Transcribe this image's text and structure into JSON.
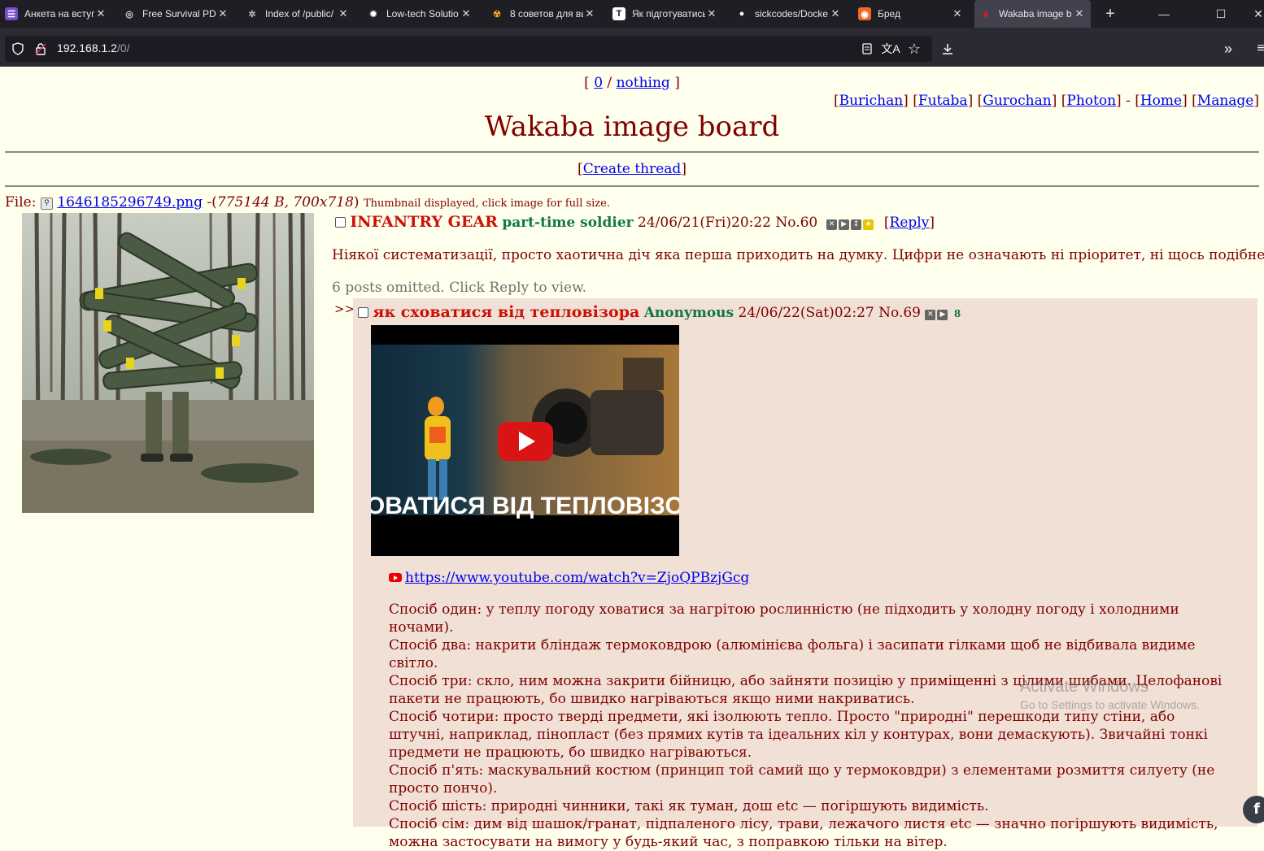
{
  "browser": {
    "tabs": [
      {
        "label": "Анкета на вступ",
        "icon": "form-icon",
        "icon_glyph": "☰",
        "icon_bg": "#7b4bd0",
        "active": false
      },
      {
        "label": "Free Survival PDF",
        "icon": "globe-icon",
        "icon_glyph": "◎",
        "icon_bg": "#1f1e25",
        "active": false
      },
      {
        "label": "Index of /public/",
        "icon": "spark-icon",
        "icon_glyph": "✲",
        "icon_bg": "#1f1e25",
        "active": false
      },
      {
        "label": "Low-tech Solutio",
        "icon": "sun-icon",
        "icon_glyph": "✹",
        "icon_bg": "#1f1e25",
        "active": false
      },
      {
        "label": "8 советов для вы",
        "icon": "radiation-icon",
        "icon_glyph": "☢",
        "icon_bg": "#1f1e25",
        "active": false
      },
      {
        "label": "Як підготуватись",
        "icon": "t-letter-icon",
        "icon_glyph": "T",
        "icon_bg": "#ffffff",
        "active": false
      },
      {
        "label": "sickcodes/Docke",
        "icon": "github-icon",
        "icon_glyph": "●",
        "icon_bg": "#1f1e25",
        "active": false
      },
      {
        "label": "Бред",
        "icon": "chat-icon",
        "icon_glyph": "◉",
        "icon_bg": "#f06a1d",
        "active": false
      },
      {
        "label": "Wakaba image b",
        "icon": "wakaba-drop-icon",
        "icon_glyph": "♦",
        "icon_bg": "#1f1e25",
        "active": true
      }
    ],
    "new_tab_glyph": "+",
    "url_host": "192.168.1.2",
    "url_path": "/0/"
  },
  "page": {
    "topnav": {
      "open": "[",
      "board": "0",
      "sep": "/",
      "nothing": "nothing",
      "close": "]"
    },
    "board_links": [
      {
        "label": "Burichan"
      },
      {
        "label": "Futaba"
      },
      {
        "label": "Gurochan"
      },
      {
        "label": "Photon"
      }
    ],
    "board_links_sep": "-",
    "site_links": [
      {
        "label": "Home"
      },
      {
        "label": "Manage"
      }
    ],
    "logo": "Wakaba image board",
    "create_thread": "Create thread",
    "file": {
      "label": "File:",
      "name": "1646185296749.png",
      "meta_prefix": "-(",
      "meta": "775144 B, 700x718",
      "meta_suffix": ")",
      "note": "Thumbnail displayed, click image for full size."
    },
    "op": {
      "subject": "INFANTRY GEAR",
      "name": "part-time soldier",
      "date": "24/06/21(Fri)20:22",
      "no": "No.60",
      "reply": "Reply",
      "text": "Ніякої систематизації, просто хаотична діч яка перша приходить на думку. Цифри не означають ні пріоритет, ні щось подібне."
    },
    "omitted": "6 posts omitted. Click Reply to view.",
    "reply": {
      "arrow": ">>",
      "subject": "як сховатися від тепловізора",
      "name": "Anonymous",
      "date": "24/06/22(Sat)02:27",
      "no": "No.69",
      "count": "8",
      "video_caption": "СХОВАТИСЯ ВІД ТЕПЛОВІЗОРА",
      "link": "https://www.youtube.com/watch?v=ZjoQPBzjGcg",
      "lines": [
        "Спосіб один: у теплу погоду ховатися за нагрітою рослинністю (не підходить у холодну погоду і холодними ночами).",
        "Спосіб два: накрити бліндаж термоковдрою (алюмінієва фольга) і засипати гілками щоб не відбивала видиме світло.",
        "Спосіб три: скло, ним можна закрити бійницю, або зайняти позицію у приміщенні з цілими шибами. Целофанові пакети не працюють, бо швидко нагріваються якщо ними накриватись.",
        "Спосіб чотири: просто тверді предмети, які ізолюють тепло. Просто \"природні\" перешкоди типу стіни, або штучні, наприклад, пінопласт (без прямих кутів та ідеальних кіл у контурах, вони демаскують). Звичайні тонкі предмети не працюють, бо швидко нагріваються.",
        "Спосіб п'ять: маскувальний костюм (принцип той самий що у термоковдри) з елементами розмиття силуету (не просто пончо).",
        "Спосіб шість: природні чинники, такі як туман, дош etc — погіршують видимість.",
        "Спосіб сім: дим від шашок/гранат, підпаленого лісу, трави, лежачого листя etc — значно погіршують видимість, можна застосувати на вимогу у будь-який час, з поправкою тільки на вітер."
      ]
    }
  },
  "os": {
    "activate_title": "Activate Windows",
    "activate_sub": "Go to Settings to activate Windows."
  },
  "colors": {
    "background": "#ffffee",
    "post_text": "#800000",
    "subject": "#cc1105",
    "poster": "#117743",
    "reply_bg": "#f0e0d6",
    "link": "#0000ee"
  }
}
